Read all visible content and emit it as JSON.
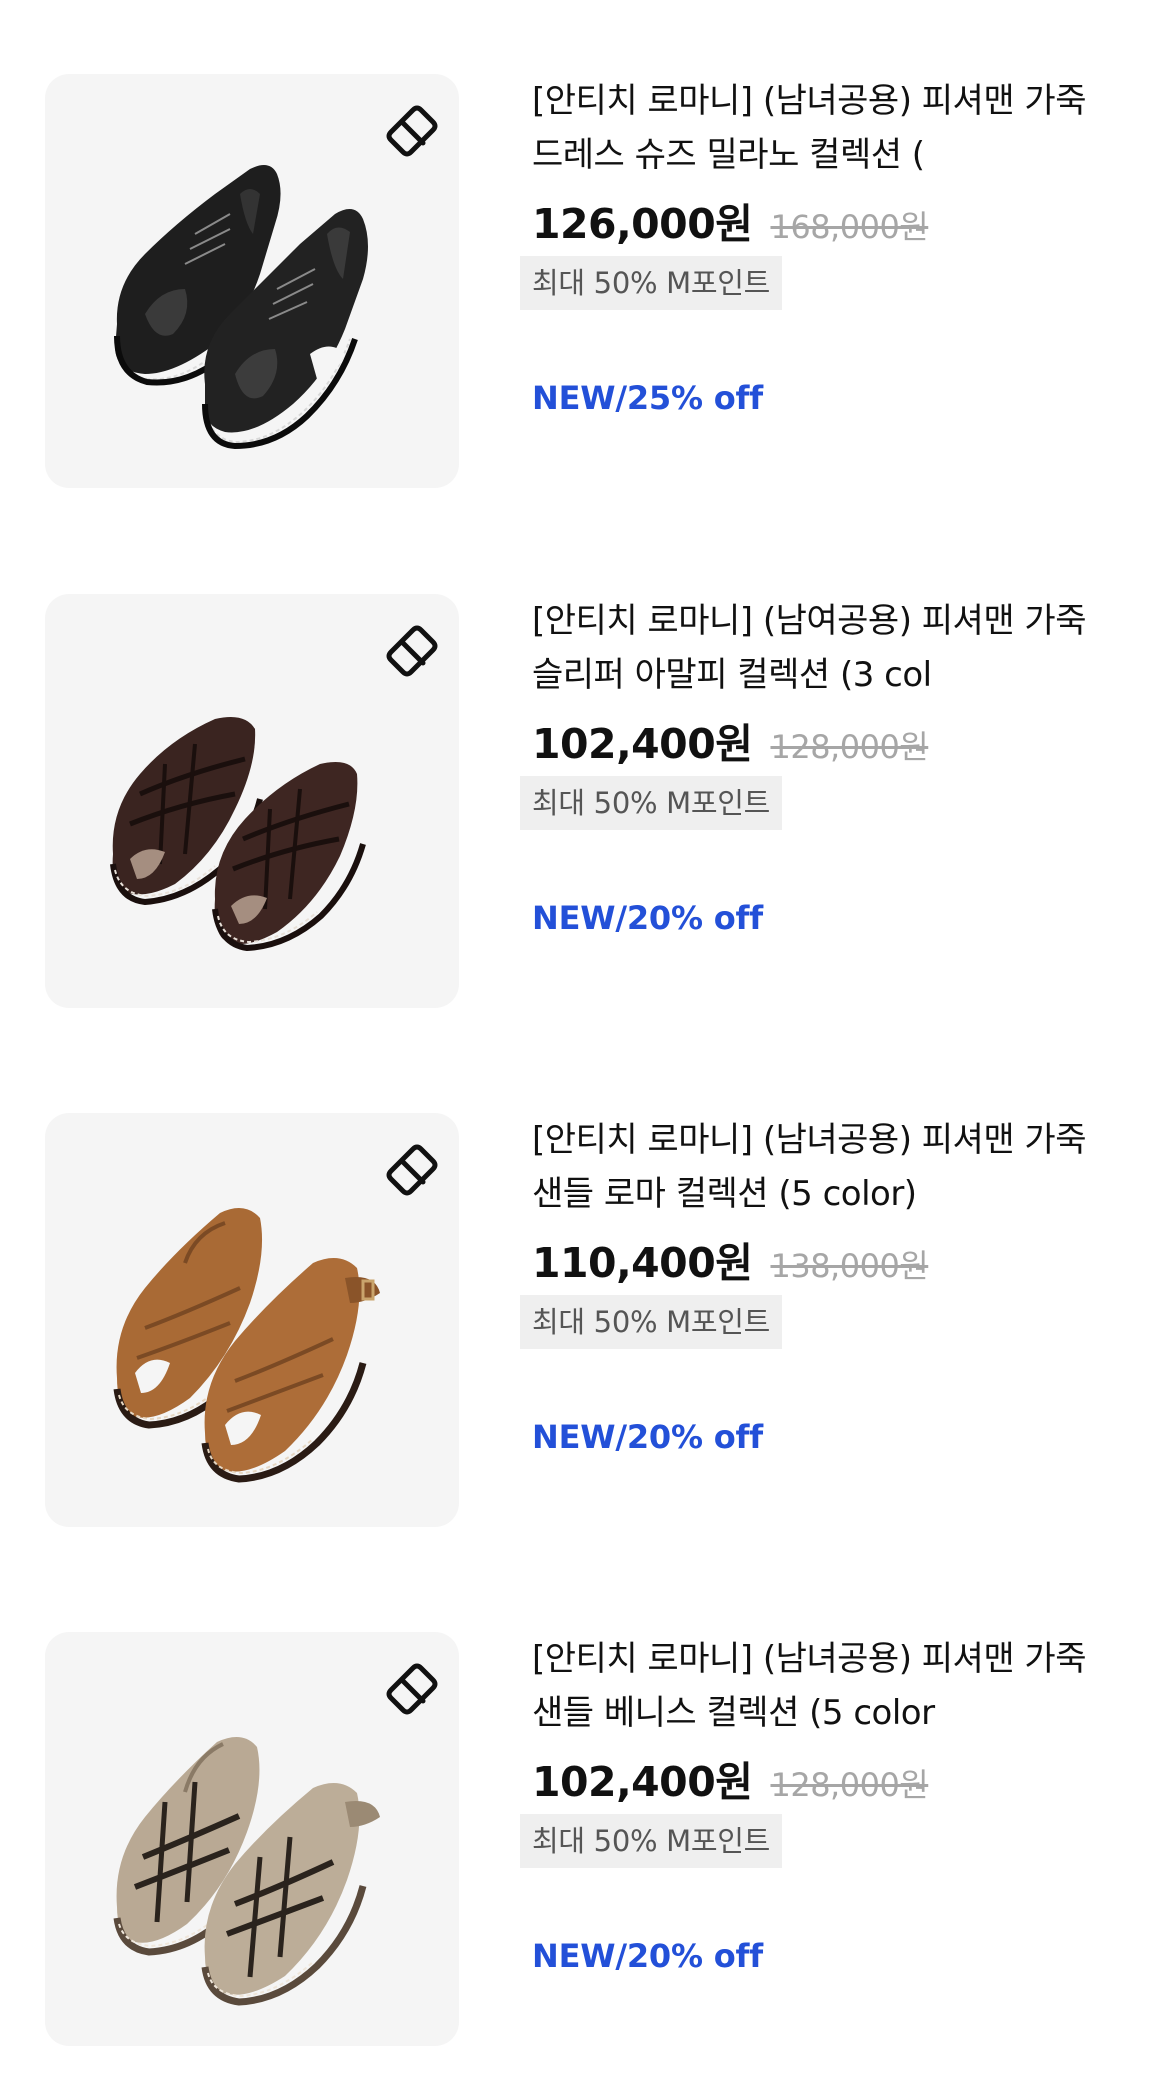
{
  "products": [
    {
      "title": "[안티치 로마니] (남녀공용) 피셔맨 가죽 드레스 슈즈 밀라노 컬렉션 (",
      "price": "126,000원",
      "original_price": "168,000원",
      "point_badge": "최대 50% M포인트",
      "promo": "NEW/25% off",
      "image_icon": "black-leather-fisherman-shoes-image",
      "color": "#1c1c1c"
    },
    {
      "title": "[안티치 로마니] (남여공용) 피셔맨 가죽 슬리퍼 아말피 컬렉션 (3 col",
      "price": "102,400원",
      "original_price": "128,000원",
      "point_badge": "최대 50% M포인트",
      "promo": "NEW/20% off",
      "image_icon": "brown-leather-fisherman-slippers-image",
      "color": "#3b2621"
    },
    {
      "title": "[안티치 로마니] (남녀공용) 피셔맨 가죽 샌들 로마 컬렉션 (5 color)",
      "price": "110,400원",
      "original_price": "138,000원",
      "point_badge": "최대 50% M포인트",
      "promo": "NEW/20% off",
      "image_icon": "tan-suede-fisherman-sandals-image",
      "color": "#a86a36"
    },
    {
      "title": "[안티치 로마니] (남녀공용) 피셔맨 가죽 샌들 베니스 컬렉션 (5 color",
      "price": "102,400원",
      "original_price": "128,000원",
      "point_badge": "최대 50% M포인트",
      "promo": "NEW/20% off",
      "image_icon": "beige-suede-fisherman-sandals-image",
      "color": "#b5a593"
    }
  ],
  "colors": {
    "promo": "#2350d8",
    "badge_bg": "#efefef",
    "thumb_bg": "#f5f5f5",
    "strike": "#a6a6a6"
  },
  "icons": {
    "wishlist": "wishlist-tag-icon"
  }
}
